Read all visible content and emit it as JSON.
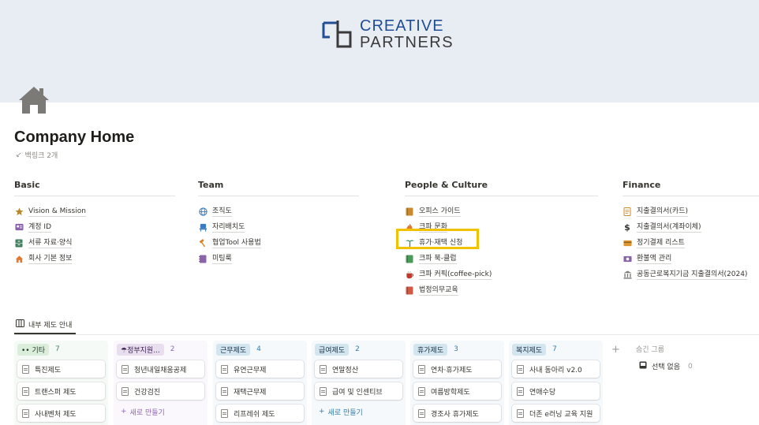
{
  "logo": {
    "line1": "CREATIVE",
    "line2": "PARTNERS"
  },
  "page": {
    "title": "Company Home",
    "backlinks": "백링크 2개"
  },
  "columns": [
    {
      "heading": "Basic",
      "items": [
        {
          "icon": "star-icon",
          "label": "Vision & Mission"
        },
        {
          "icon": "id-card-icon",
          "label": "계정 ID"
        },
        {
          "icon": "file-cabinet-icon",
          "label": "서류 자료·양식"
        },
        {
          "icon": "house-icon",
          "label": "회사 기본 정보"
        }
      ]
    },
    {
      "heading": "Team",
      "items": [
        {
          "icon": "globe-icon",
          "label": "조직도"
        },
        {
          "icon": "seat-icon",
          "label": "자리배치도"
        },
        {
          "icon": "hammer-icon",
          "label": "협업Tool 사용법"
        },
        {
          "icon": "notebook-icon",
          "label": "미팅룩"
        }
      ]
    },
    {
      "heading": "People & Culture",
      "items": [
        {
          "icon": "book-icon",
          "label": "오피스 가이드"
        },
        {
          "icon": "flame-icon",
          "label": "크파 문화"
        },
        {
          "icon": "palm-tree-icon",
          "label": "휴가·재택 신청"
        },
        {
          "icon": "green-book-icon",
          "label": "크파 북-클럽"
        },
        {
          "icon": "coffee-icon",
          "label": "크파 커픽(coffee-pick)"
        },
        {
          "icon": "red-book-icon",
          "label": "법정의무교육"
        }
      ]
    },
    {
      "heading": "Finance",
      "items": [
        {
          "icon": "document-icon",
          "label": "지출결의서(카드)"
        },
        {
          "icon": "dollar-icon",
          "label": "지출결의서(계좌이체)"
        },
        {
          "icon": "card-icon",
          "label": "정기결제 리스트"
        },
        {
          "icon": "money-icon",
          "label": "환불액 관리"
        },
        {
          "icon": "bank-icon",
          "label": "공동근로복지기금 지출결의서(2024)"
        }
      ]
    }
  ],
  "view": {
    "tab_label": "내부 제도 안내"
  },
  "board": {
    "new_label": "새로 만들기",
    "groups": [
      {
        "name": "기타",
        "count": "7",
        "bg": "#f6faf6",
        "tag_bg": "#dbeddb",
        "tag_color": "#1c3829",
        "count_color": "#448361",
        "cards": [
          "특진제도",
          "트랜스퍼 제도",
          "사내벤처 제도"
        ],
        "show_new": false
      },
      {
        "name": "정부지원...",
        "count": "2",
        "bg": "#faf8fc",
        "tag_bg": "#e8deee",
        "tag_color": "#412454",
        "count_color": "#9065b0",
        "cards": [
          "청년내일채움공제",
          "건강검진"
        ],
        "show_new": true
      },
      {
        "name": "근무제도",
        "count": "4",
        "bg": "#f5f9fc",
        "tag_bg": "#d3e5ef",
        "tag_color": "#183347",
        "count_color": "#337ea9",
        "cards": [
          "유연근무제",
          "재택근무제",
          "리프레쉬 제도"
        ],
        "show_new": false
      },
      {
        "name": "급여제도",
        "count": "2",
        "bg": "#f5f9fc",
        "tag_bg": "#d3e5ef",
        "tag_color": "#183347",
        "count_color": "#337ea9",
        "cards": [
          "연말정산",
          "급여 및 인센티브"
        ],
        "show_new": true
      },
      {
        "name": "휴가제도",
        "count": "3",
        "bg": "#f5f9fc",
        "tag_bg": "#d3e5ef",
        "tag_color": "#183347",
        "count_color": "#337ea9",
        "cards": [
          "연차·휴가제도",
          "여름방학제도",
          "경조사 휴가제도"
        ],
        "show_new": false
      },
      {
        "name": "복지제도",
        "count": "7",
        "bg": "#f5f9fc",
        "tag_bg": "#d3e5ef",
        "tag_color": "#183347",
        "count_color": "#337ea9",
        "cards": [
          "사내 동아리 v2.0",
          "연애수당",
          "더존 e러닝 교육 지원"
        ],
        "show_new": false
      }
    ],
    "hidden_groups_label": "숨긴 그룹",
    "hidden_item": {
      "label": "선택 없음",
      "count": "0"
    }
  },
  "colors": {
    "highlight": "#f2c200",
    "logo_blue": "#1f4e96",
    "cover_bg": "#e8ecf3"
  }
}
